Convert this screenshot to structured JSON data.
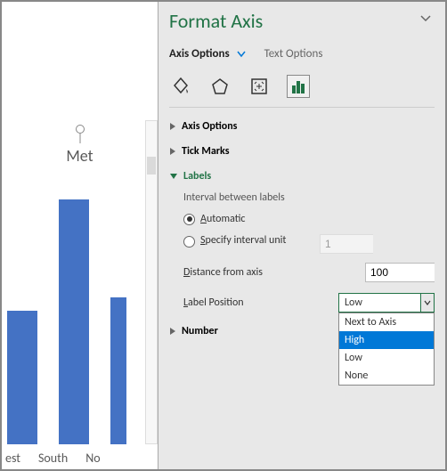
{
  "chart_data": {
    "type": "bar",
    "title": "Met",
    "categories": [
      "est",
      "South",
      "No"
    ],
    "values": [
      150,
      275,
      165
    ],
    "ylim": [
      0,
      310
    ]
  },
  "pane": {
    "title": "Format Axis",
    "tabs": {
      "axis": "Axis Options",
      "text": "Text Options"
    },
    "sections": {
      "axis_options": "Axis Options",
      "tick_marks": "Tick Marks",
      "labels": "Labels",
      "number": "Number"
    },
    "labels_section": {
      "interval_label": "Interval between labels",
      "auto": "Automatic",
      "specify": "Specify interval unit",
      "specify_value": "1",
      "distance_label": "Distance from axis",
      "distance_value": "100",
      "label_position": "Label Position",
      "position_value": "Low",
      "options": [
        "Next to Axis",
        "High",
        "Low",
        "None"
      ]
    }
  },
  "chart_axis_labels": [
    "est",
    "South",
    "No"
  ]
}
